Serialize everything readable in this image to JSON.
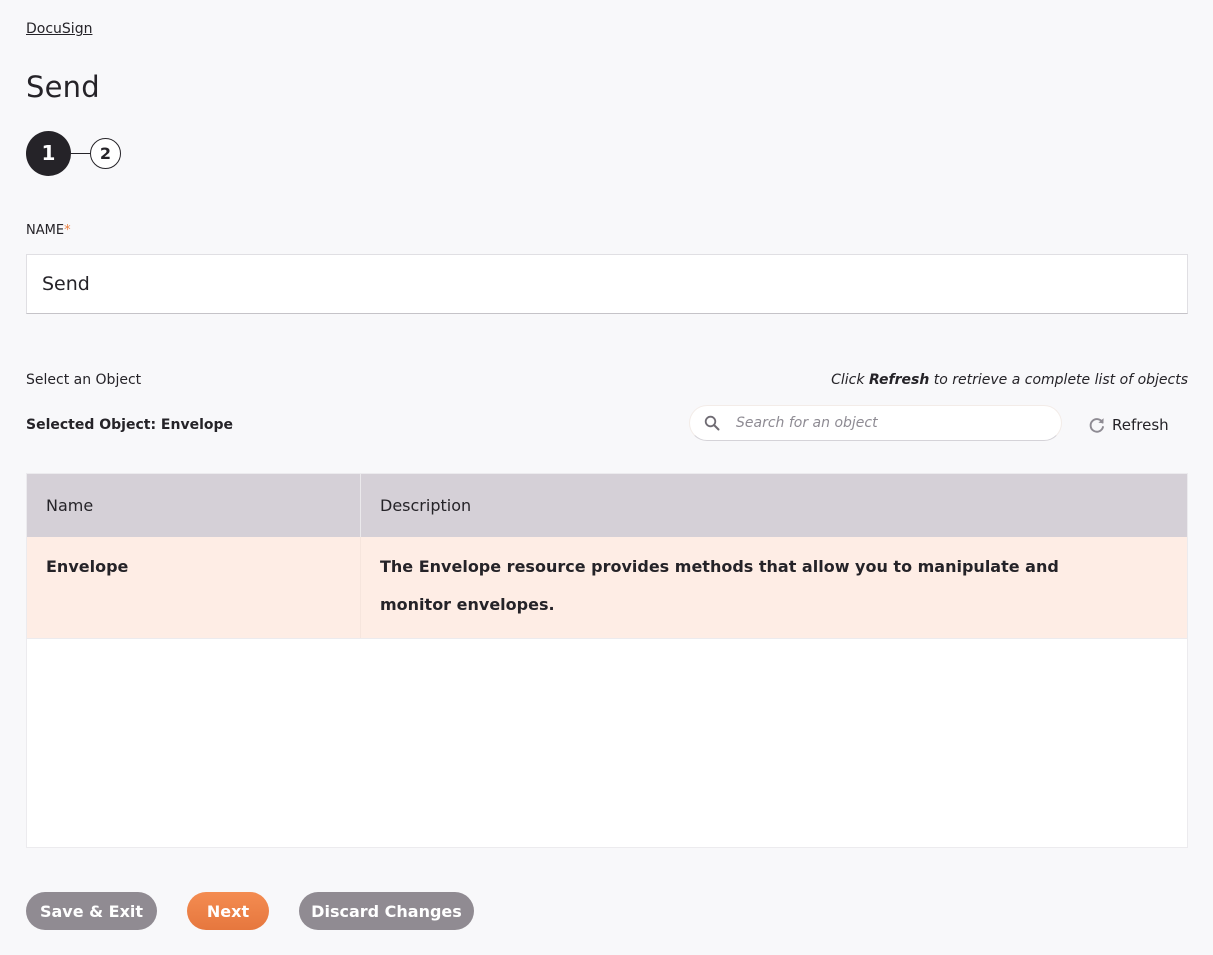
{
  "breadcrumb": {
    "label": "DocuSign"
  },
  "header": {
    "title": "Send"
  },
  "stepper": {
    "steps": [
      {
        "number": "1",
        "state": "active"
      },
      {
        "number": "2",
        "state": "inactive"
      }
    ]
  },
  "form": {
    "name_label": "NAME",
    "required_marker": "*",
    "name_value": "Send"
  },
  "object_selection": {
    "label": "Select an Object",
    "hint_prefix": "Click ",
    "hint_bold": "Refresh",
    "hint_suffix": " to retrieve a complete list of objects",
    "selected_label": "Selected Object: Envelope",
    "search_placeholder": "Search for an object",
    "search_value": "",
    "refresh_label": "Refresh"
  },
  "table": {
    "columns": [
      "Name",
      "Description"
    ],
    "rows": [
      {
        "name": "Envelope",
        "description": "The Envelope resource provides methods that allow you to manipulate and monitor envelopes.",
        "selected": true
      }
    ]
  },
  "footer": {
    "save_exit_label": "Save & Exit",
    "next_label": "Next",
    "discard_label": "Discard Changes"
  },
  "colors": {
    "accent": "#ec7f3e",
    "selected_row": "#feede5",
    "header_bg": "#d5d0d7",
    "secondary_button": "#908b92",
    "text": "#252328"
  }
}
